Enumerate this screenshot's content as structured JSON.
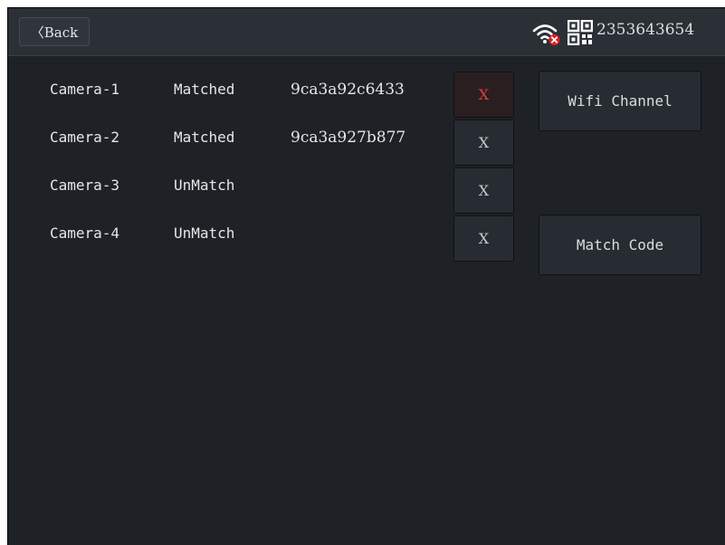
{
  "header": {
    "back_label": "〈Back",
    "device_id": "2353643654",
    "wifi_icon": "wifi-disconnected-icon",
    "qr_icon": "qr-code-icon"
  },
  "cameras": [
    {
      "name": "Camera-1",
      "status": "Matched",
      "mac": "9ca3a92c6433",
      "remove_label": "X",
      "remove_active": true
    },
    {
      "name": "Camera-2",
      "status": "Matched",
      "mac": "9ca3a927b877",
      "remove_label": "X",
      "remove_active": false
    },
    {
      "name": "Camera-3",
      "status": "UnMatch",
      "mac": "",
      "remove_label": "X",
      "remove_active": false
    },
    {
      "name": "Camera-4",
      "status": "UnMatch",
      "mac": "",
      "remove_label": "X",
      "remove_active": false
    }
  ],
  "actions": {
    "wifi_channel_label": "Wifi Channel",
    "match_code_label": "Match Code"
  },
  "colors": {
    "background": "#1e2227",
    "topbar": "#2b3037",
    "active_x": "#e04040",
    "wifi_alert": "#e02020"
  }
}
